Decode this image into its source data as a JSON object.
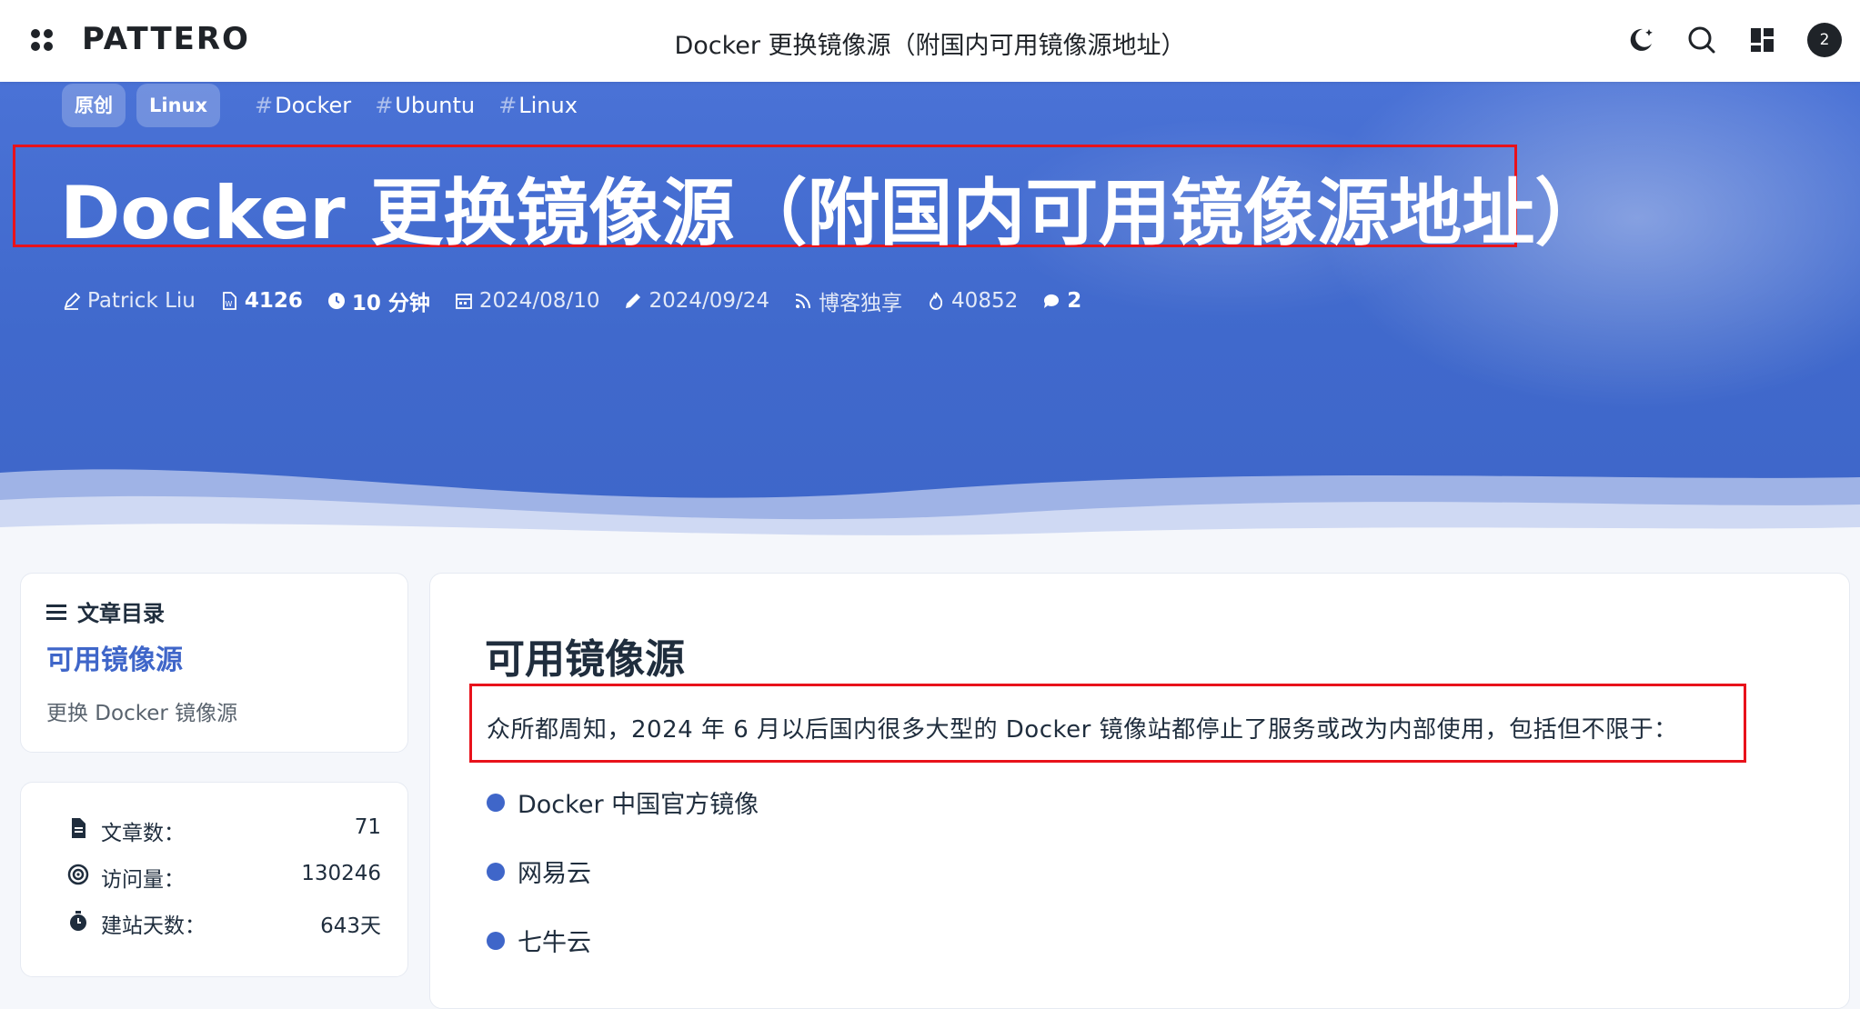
{
  "topbar": {
    "logo": "PATTERO",
    "title": "Docker 更换镜像源（附国内可用镜像源地址）",
    "badge_count": "2",
    "icons": [
      "grid-menu-icon",
      "moon-icon",
      "search-icon",
      "dashboard-icon"
    ]
  },
  "hero": {
    "pills": [
      "原创",
      "Linux"
    ],
    "hashtags": [
      "Docker",
      "Ubuntu",
      "Linux"
    ],
    "hash_symbol": "#",
    "title": "Docker 更换镜像源（附国内可用镜像源地址）",
    "meta": {
      "author": "Patrick Liu",
      "word_count": "4126",
      "read_time": "10 分钟",
      "created": "2024/08/10",
      "updated": "2024/09/24",
      "source": "博客独享",
      "views": "40852",
      "comments": "2"
    },
    "colors": {
      "background": "#4069cc",
      "highlight_border": "#e8121b"
    }
  },
  "sidebar": {
    "toc": {
      "heading": "文章目录",
      "active": "可用镜像源",
      "items": [
        "更换 Docker 镜像源"
      ]
    },
    "stats": [
      {
        "icon": "file-icon",
        "label": "文章数：",
        "value": "71"
      },
      {
        "icon": "target-icon",
        "label": "访问量：",
        "value": "130246"
      },
      {
        "icon": "stopwatch-icon",
        "label": "建站天数：",
        "value": "643天"
      }
    ]
  },
  "article": {
    "heading": "可用镜像源",
    "intro": "众所都周知，2024 年 6 月以后国内很多大型的 Docker 镜像站都停止了服务或改为内部使用，包括但不限于：",
    "list": [
      "Docker 中国官方镜像",
      "网易云",
      "七牛云"
    ],
    "accent": "#3f66c9"
  }
}
